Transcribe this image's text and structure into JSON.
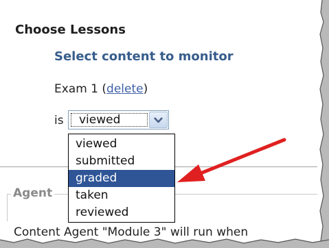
{
  "panel": {
    "title": "Choose Lessons",
    "subtitle": "Select content to monitor"
  },
  "rule": {
    "name": "Exam 1",
    "open_paren": " (",
    "delete_label": "delete",
    "close_paren": ")",
    "operator_label": "is"
  },
  "status_select": {
    "value": "viewed",
    "options": [
      "viewed",
      "submitted",
      "graded",
      "taken",
      "reviewed"
    ],
    "highlighted_option": "graded"
  },
  "agent_section": {
    "legend": "Agent",
    "text": "Content Agent \"Module 3\" will run when"
  },
  "icons": {
    "dropdown_arrow": "chevron-down-icon",
    "annotation_arrow": "red-arrow-icon"
  },
  "colors": {
    "title": "#1f1f1f",
    "subtitle": "#375d8c",
    "link": "#3d5fa8",
    "selection": "#2f5597",
    "annotation_arrow": "#e02020"
  }
}
